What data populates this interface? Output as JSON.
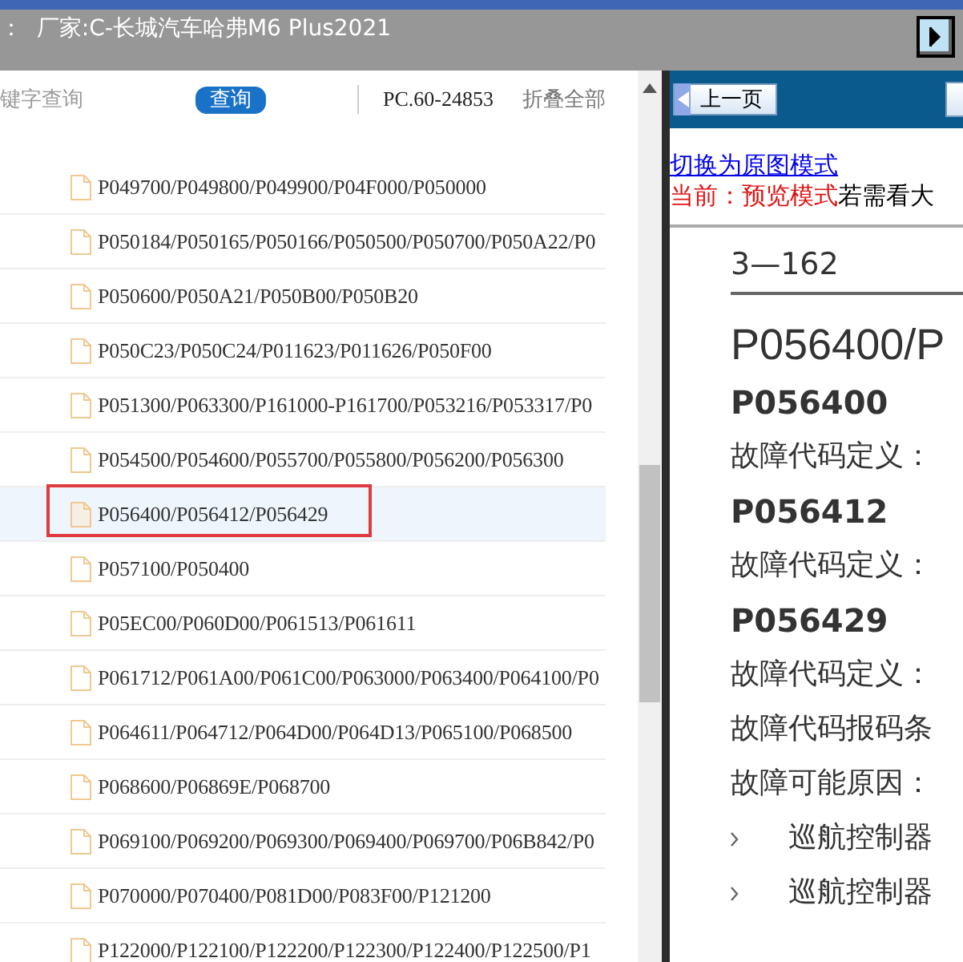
{
  "title_bar": {
    "title": "：  厂家:C-长城汽车哈弗M6 Plus2021"
  },
  "tree_panel": {
    "search": {
      "placeholder": "键字查询"
    },
    "search_button": "查询",
    "code": "PC.60-24853",
    "collapse_all": "折叠全部",
    "items": [
      {
        "label": "P049700/P049800/P049900/P04F000/P050000",
        "selected": false
      },
      {
        "label": "P050184/P050165/P050166/P050500/P050700/P050A22/P0",
        "selected": false
      },
      {
        "label": "P050600/P050A21/P050B00/P050B20",
        "selected": false
      },
      {
        "label": "P050C23/P050C24/P011623/P011626/P050F00",
        "selected": false
      },
      {
        "label": "P051300/P063300/P161000-P161700/P053216/P053317/P0",
        "selected": false
      },
      {
        "label": "P054500/P054600/P055700/P055800/P056200/P056300",
        "selected": false
      },
      {
        "label": "P056400/P056412/P056429",
        "selected": true
      },
      {
        "label": "P057100/P050400",
        "selected": false
      },
      {
        "label": "P05EC00/P060D00/P061513/P061611",
        "selected": false
      },
      {
        "label": "P061712/P061A00/P061C00/P063000/P063400/P064100/P0",
        "selected": false
      },
      {
        "label": "P064611/P064712/P064D00/P064D13/P065100/P068500",
        "selected": false
      },
      {
        "label": "P068600/P06869E/P068700",
        "selected": false
      },
      {
        "label": "P069100/P069200/P069300/P069400/P069700/P06B842/P0",
        "selected": false
      },
      {
        "label": "P070000/P070400/P081D00/P083F00/P121200",
        "selected": false
      },
      {
        "label": "P122000/P122100/P122200/P122300/P122400/P122500/P1",
        "selected": false
      }
    ]
  },
  "doc_panel": {
    "prev_button": "上一页",
    "switch_link": "切换为原图模式",
    "mode_label": "当前：预览模式",
    "mode_hint": "若需看大",
    "page": {
      "page_number": "3—162",
      "heading": "P056400/P",
      "lines": [
        {
          "kind": "code",
          "text": "P056400"
        },
        {
          "kind": "text",
          "text": "故障代码定义："
        },
        {
          "kind": "code",
          "text": "P056412"
        },
        {
          "kind": "text",
          "text": "故障代码定义："
        },
        {
          "kind": "code",
          "text": "P056429"
        },
        {
          "kind": "text",
          "text": "故障代码定义："
        },
        {
          "kind": "text",
          "text": "故障代码报码条"
        },
        {
          "kind": "text",
          "text": "故障可能原因："
        },
        {
          "kind": "bullet",
          "text": "巡航控制器"
        },
        {
          "kind": "bullet",
          "text": "巡航控制器"
        }
      ]
    }
  }
}
